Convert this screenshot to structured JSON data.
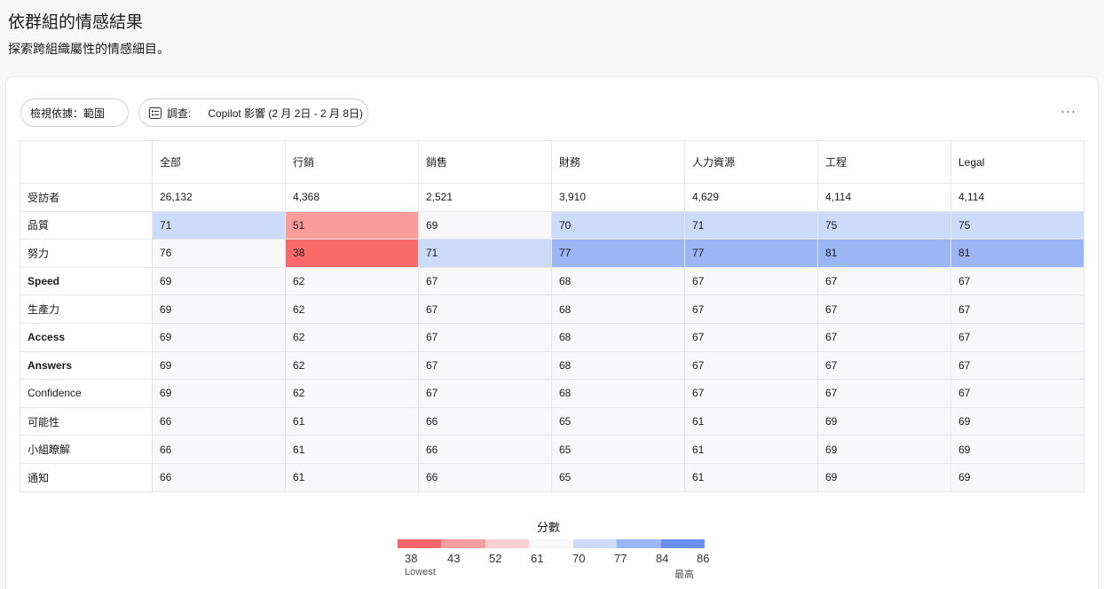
{
  "header": {
    "title": "依群組的情感結果",
    "subtitle": "探索跨組織屬性的情感細目。"
  },
  "filters": {
    "view_by_label": "檢視依據：範圍",
    "survey_label": "調查:",
    "survey_value": "Copilot 影響 (2 月 2日 - 2 月 8日)",
    "more_label": "···"
  },
  "table": {
    "columns": [
      "",
      "全部",
      "行銷",
      "銷售",
      "財務",
      "人力資源",
      "工程",
      "Legal"
    ],
    "rows": [
      {
        "label": "受訪者",
        "bold": false,
        "values": [
          "26,132",
          "4,368",
          "2,521",
          "3,910",
          "4,629",
          "4,114",
          "4,114"
        ],
        "colors": [
          "#ffffff",
          "#ffffff",
          "#ffffff",
          "#ffffff",
          "#ffffff",
          "#ffffff",
          "#ffffff"
        ]
      },
      {
        "label": "品質",
        "bold": false,
        "values": [
          "71",
          "51",
          "69",
          "70",
          "71",
          "75",
          "75"
        ],
        "colors": [
          "#cddbfa",
          "#fb9c9c",
          "#f8f8fa",
          "#cddbfa",
          "#cddbfa",
          "#cddbfa",
          "#cddbfa"
        ]
      },
      {
        "label": "努力",
        "bold": false,
        "values": [
          "76",
          "38",
          "71",
          "77",
          "77",
          "81",
          "81"
        ],
        "colors": [
          "#f8f8fa",
          "#fb6a6a",
          "#cddbfa",
          "#9cb5f4",
          "#9cb5f4",
          "#9cb5f4",
          "#9cb5f4"
        ]
      },
      {
        "label": "Speed",
        "bold": true,
        "values": [
          "69",
          "62",
          "67",
          "68",
          "67",
          "67",
          "67"
        ],
        "colors": [
          "#f8f8fa",
          "#f8f8fa",
          "#f8f8fa",
          "#f8f8fa",
          "#f8f8fa",
          "#f8f8fa",
          "#f8f8fa"
        ]
      },
      {
        "label": "生產力",
        "bold": false,
        "values": [
          "69",
          "62",
          "67",
          "68",
          "67",
          "67",
          "67"
        ],
        "colors": [
          "#f8f8fa",
          "#f8f8fa",
          "#f8f8fa",
          "#f8f8fa",
          "#f8f8fa",
          "#f8f8fa",
          "#f8f8fa"
        ]
      },
      {
        "label": "Access",
        "bold": true,
        "values": [
          "69",
          "62",
          "67",
          "68",
          "67",
          "67",
          "67"
        ],
        "colors": [
          "#f8f8fa",
          "#f8f8fa",
          "#f8f8fa",
          "#f8f8fa",
          "#f8f8fa",
          "#f8f8fa",
          "#f8f8fa"
        ]
      },
      {
        "label": "Answers",
        "bold": true,
        "values": [
          "69",
          "62",
          "67",
          "68",
          "67",
          "67",
          "67"
        ],
        "colors": [
          "#f8f8fa",
          "#f8f8fa",
          "#f8f8fa",
          "#f8f8fa",
          "#f8f8fa",
          "#f8f8fa",
          "#f8f8fa"
        ]
      },
      {
        "label": "Confidence",
        "bold": false,
        "values": [
          "69",
          "62",
          "67",
          "68",
          "67",
          "67",
          "67"
        ],
        "colors": [
          "#f8f8fa",
          "#f8f8fa",
          "#f8f8fa",
          "#f8f8fa",
          "#f8f8fa",
          "#f8f8fa",
          "#f8f8fa"
        ]
      },
      {
        "label": "可能性",
        "bold": false,
        "values": [
          "66",
          "61",
          "66",
          "65",
          "61",
          "69",
          "69"
        ],
        "colors": [
          "#f8f8fa",
          "#f8f8fa",
          "#f8f8fa",
          "#f8f8fa",
          "#f8f8fa",
          "#f8f8fa",
          "#f8f8fa"
        ]
      },
      {
        "label": "小組瞭解",
        "bold": false,
        "values": [
          "66",
          "61",
          "66",
          "65",
          "61",
          "69",
          "69"
        ],
        "colors": [
          "#f8f8fa",
          "#f8f8fa",
          "#f8f8fa",
          "#f8f8fa",
          "#f8f8fa",
          "#f8f8fa",
          "#f8f8fa"
        ]
      },
      {
        "label": "通知",
        "bold": false,
        "values": [
          "66",
          "61",
          "66",
          "65",
          "61",
          "69",
          "69"
        ],
        "colors": [
          "#f8f8fa",
          "#f8f8fa",
          "#f8f8fa",
          "#f8f8fa",
          "#f8f8fa",
          "#f8f8fa",
          "#f8f8fa"
        ]
      }
    ]
  },
  "legend": {
    "title": "分數",
    "ticks": [
      "38",
      "43",
      "52",
      "61",
      "70",
      "77",
      "84",
      "86"
    ],
    "low_label": "Lowest",
    "high_label": "最高",
    "colors": [
      "#f3636a",
      "#f59ea0",
      "#fad0d1",
      "#f8f8fa",
      "#cddbfa",
      "#9cb5f4",
      "#6990ee"
    ]
  }
}
